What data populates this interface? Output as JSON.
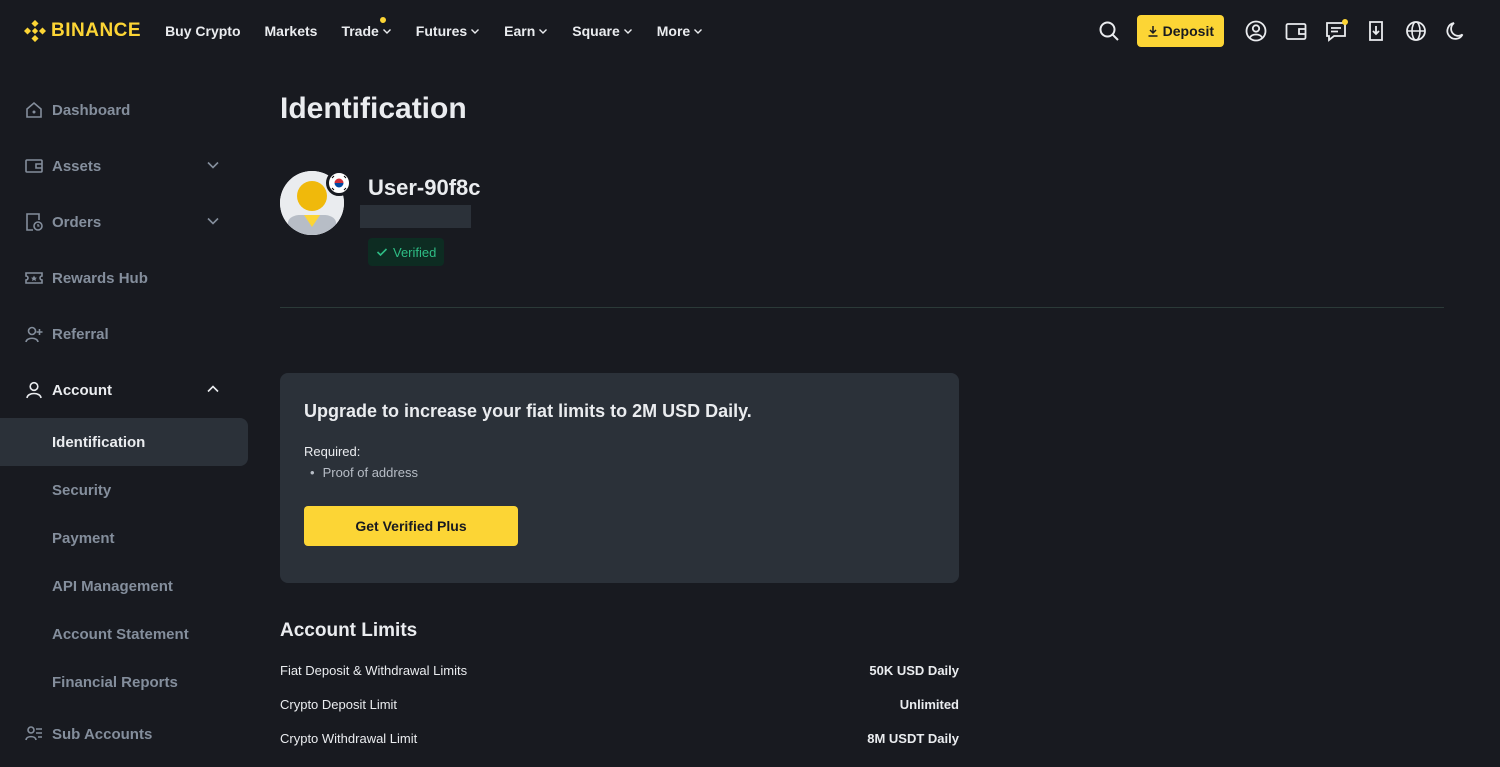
{
  "brand": {
    "name": "BINANCE",
    "color": "#fcd535"
  },
  "nav": {
    "items": [
      {
        "label": "Buy Crypto",
        "dropdown": false,
        "dot": false
      },
      {
        "label": "Markets",
        "dropdown": false,
        "dot": false
      },
      {
        "label": "Trade",
        "dropdown": true,
        "dot": true
      },
      {
        "label": "Futures",
        "dropdown": true,
        "dot": false
      },
      {
        "label": "Earn",
        "dropdown": true,
        "dot": false
      },
      {
        "label": "Square",
        "dropdown": true,
        "dot": false
      },
      {
        "label": "More",
        "dropdown": true,
        "dot": false
      }
    ],
    "deposit_label": "Deposit",
    "right_icons": [
      "search-icon",
      "user-icon",
      "wallet-icon",
      "messages-icon",
      "download-icon",
      "globe-icon",
      "theme-toggle-icon"
    ]
  },
  "sidebar": {
    "items": [
      {
        "label": "Dashboard",
        "icon": "home-icon"
      },
      {
        "label": "Assets",
        "icon": "wallet-icon",
        "expandable": true
      },
      {
        "label": "Orders",
        "icon": "orders-icon",
        "expandable": true
      },
      {
        "label": "Rewards Hub",
        "icon": "ticket-icon"
      },
      {
        "label": "Referral",
        "icon": "add-person-icon"
      },
      {
        "label": "Account",
        "icon": "person-icon",
        "expandable": true,
        "expanded": true
      }
    ],
    "account_sub": [
      {
        "label": "Identification",
        "active": true
      },
      {
        "label": "Security"
      },
      {
        "label": "Payment"
      },
      {
        "label": "API Management"
      },
      {
        "label": "Account Statement"
      },
      {
        "label": "Financial Reports"
      }
    ],
    "sub_accounts": {
      "label": "Sub Accounts",
      "icon": "people-icon"
    }
  },
  "main": {
    "title": "Identification",
    "user": {
      "name": "User-90f8c",
      "status": "Verified"
    },
    "upgrade": {
      "title": "Upgrade to increase your fiat limits to 2M USD Daily.",
      "required_label": "Required:",
      "requirement": "Proof of address",
      "button": "Get Verified Plus"
    },
    "limits": {
      "title": "Account Limits",
      "rows": [
        {
          "name": "Fiat Deposit & Withdrawal Limits",
          "value": "50K USD Daily"
        },
        {
          "name": "Crypto Deposit Limit",
          "value": "Unlimited"
        },
        {
          "name": "Crypto Withdrawal Limit",
          "value": "8M USDT Daily"
        }
      ]
    }
  },
  "colors": {
    "background": "#181a20",
    "card": "#2b3139",
    "accent": "#fcd535",
    "success": "#2ebd85",
    "muted": "#848e9c"
  }
}
